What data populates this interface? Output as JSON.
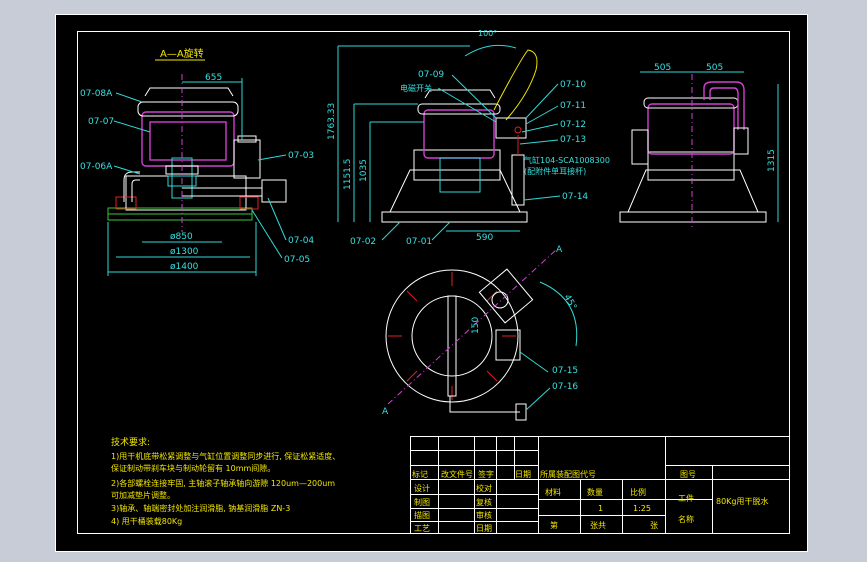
{
  "section_title": "A—A旋转",
  "part_labels_left": [
    "07-08A",
    "07-07",
    "07-06A",
    "07-03",
    "07-04",
    "07-05",
    "07-02",
    "07-01"
  ],
  "part_labels_right": [
    "07-09",
    "电磁开关",
    "07-10",
    "07-11",
    "07-12",
    "07-13",
    "07-14",
    "07-15",
    "07-16"
  ],
  "cylinder_note_1": "气缸104-SCA1008300",
  "cylinder_note_2": "(配附件单耳接杆)",
  "dims": {
    "d655": "655",
    "d850": "ø850",
    "d1300": "ø1300",
    "d1400": "ø1400",
    "d1763": "1763.33",
    "d1151": "1151.5",
    "d1035": "1035",
    "d590": "590",
    "d100": "100°",
    "d505a": "505",
    "d505b": "505",
    "d1315": "1315",
    "d150": "150",
    "d45": "45°",
    "sectA1": "A",
    "sectA2": "A"
  },
  "tech_title": "技术要求:",
  "tech_lines": [
    "1)甩干机底带松紧调整与气缸位置调整同步进行, 保证松紧适度、",
    "  保证制动带刹车块与制动轮留有 10mm间隙。",
    "2)各部螺栓连接牢固, 主轴滚子轴承轴向游隙 120um—200um",
    "  可加减垫片调整。",
    "3)轴承、轴端密封处加注润滑脂, 钠基润滑脂 ZN-3",
    "4) 甩干桶装载80Kg"
  ],
  "title_block": {
    "row1": [
      "标记",
      "改文件号",
      "签字",
      "日期"
    ],
    "assembly": "所属装配图代号",
    "design": "设计",
    "proof": "校对",
    "draw": "制图",
    "review": "复核",
    "trace": "描图",
    "audit": "审核",
    "process": "工艺",
    "date": "日期",
    "material": "材料",
    "qty": "数量",
    "ratio": "比例",
    "qty_val": "1",
    "ratio_val": "1:25",
    "sheet_no": "第",
    "sheet_of": "张共",
    "sheet_tot": "张",
    "drawing_no": "图号",
    "work": "工件",
    "name": "名称",
    "title": "80Kg甩干脱水"
  }
}
